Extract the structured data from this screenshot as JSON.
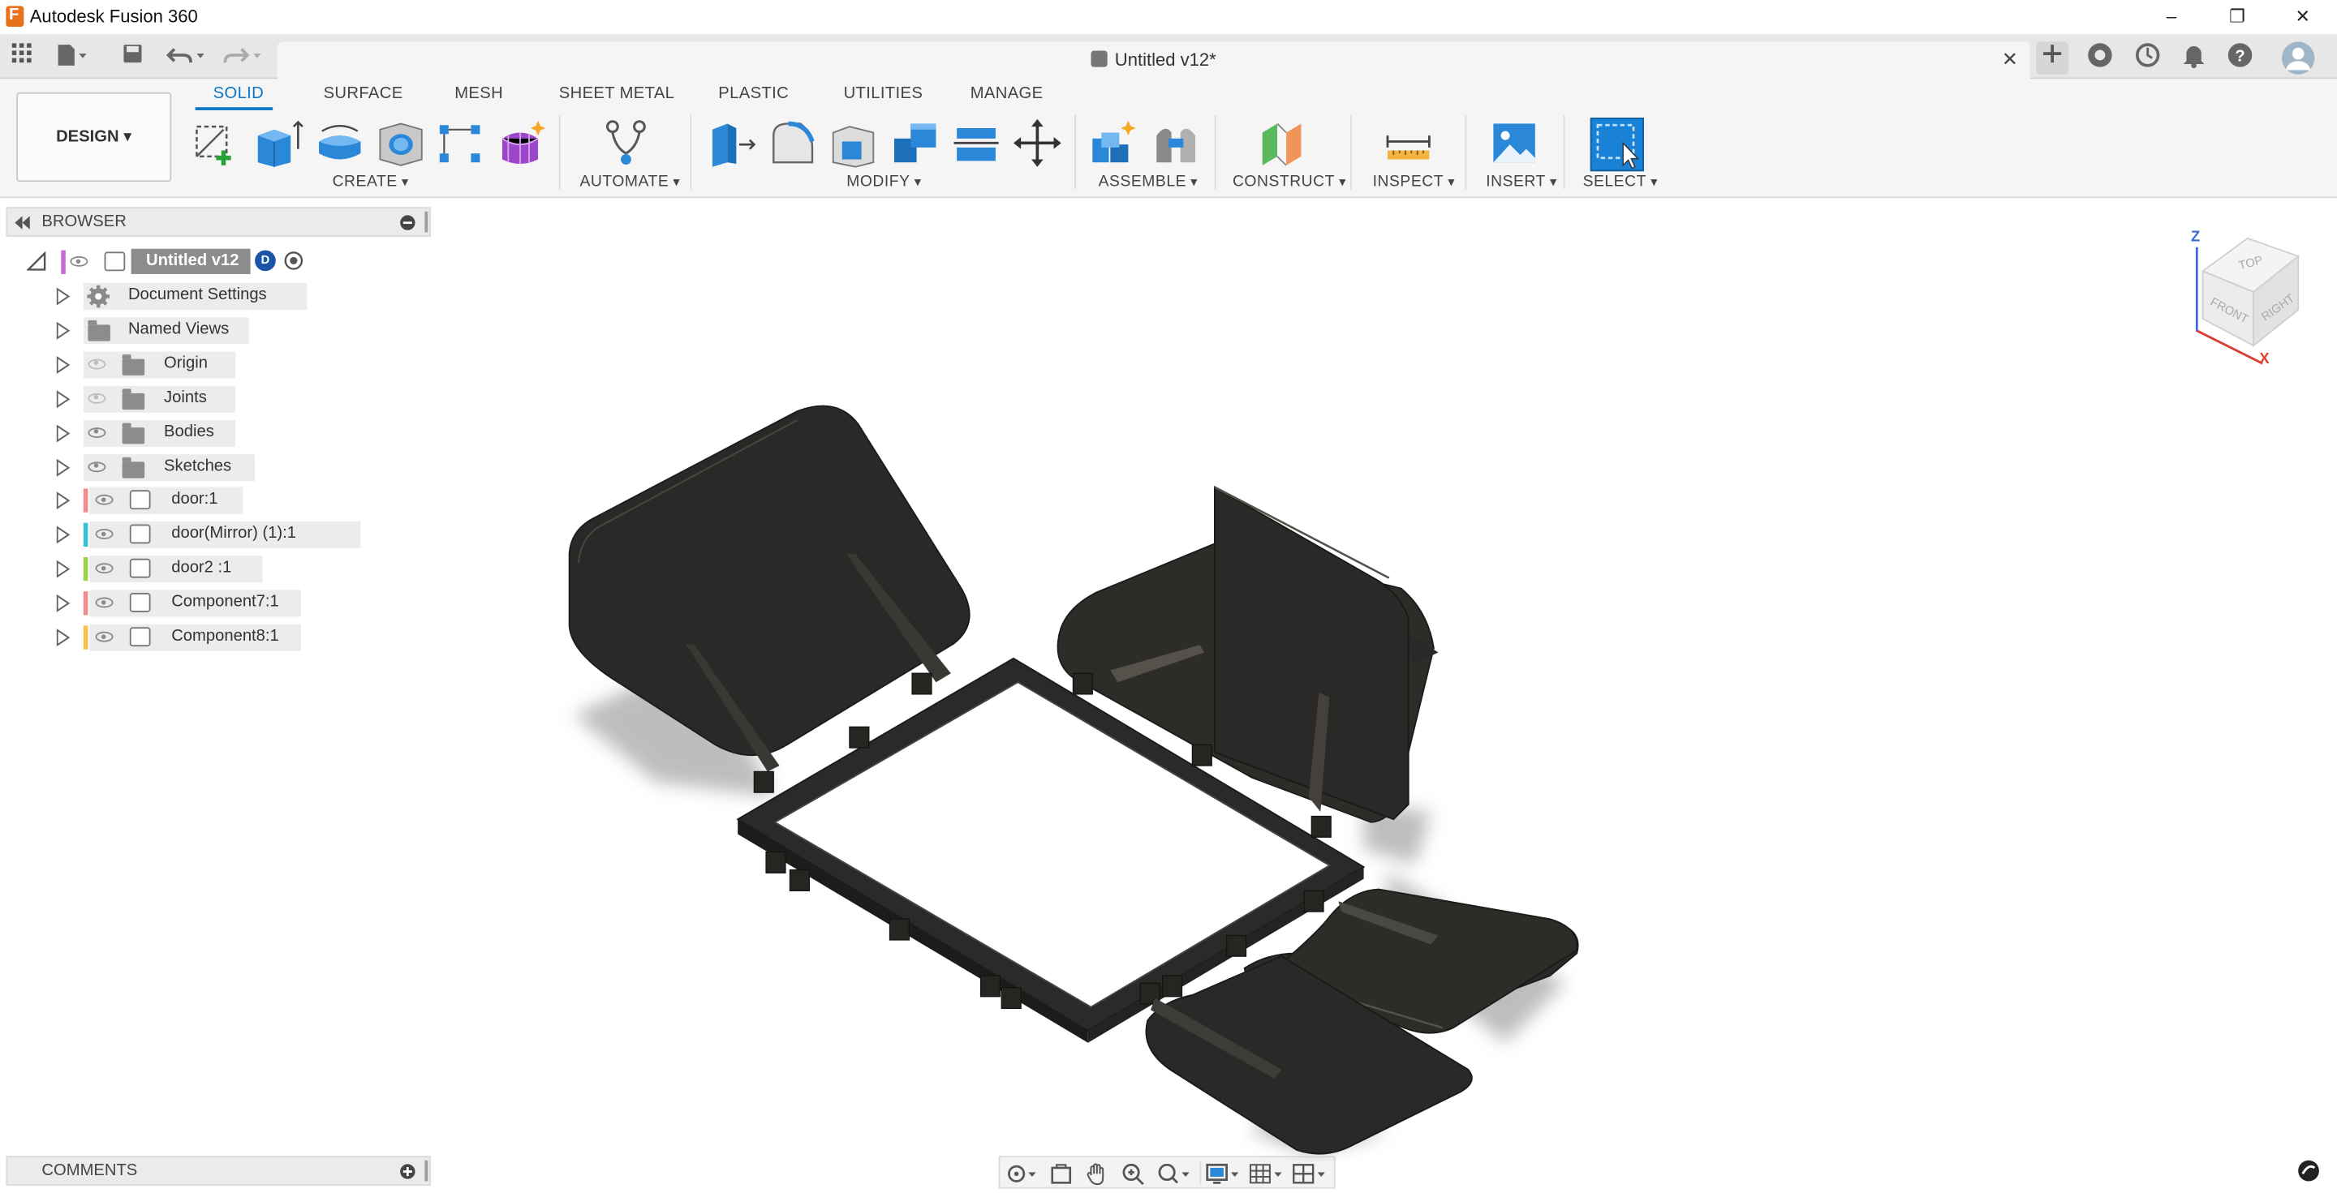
{
  "app": {
    "title": "Autodesk Fusion 360"
  },
  "window": {
    "minimize": "–",
    "restore": "❐",
    "close": "✕"
  },
  "document": {
    "tab_title": "Untitled v12*",
    "close": "✕"
  },
  "workspace": {
    "label": "DESIGN ▾"
  },
  "ribbon_tabs": [
    "SOLID",
    "SURFACE",
    "MESH",
    "SHEET METAL",
    "PLASTIC",
    "UTILITIES",
    "MANAGE"
  ],
  "ribbon_groups": {
    "create": "CREATE",
    "automate": "AUTOMATE",
    "modify": "MODIFY",
    "assemble": "ASSEMBLE",
    "construct": "CONSTRUCT",
    "inspect": "INSPECT",
    "insert": "INSERT",
    "select": "SELECT"
  },
  "browser": {
    "title": "BROWSER",
    "root": "Untitled v12",
    "items": [
      {
        "label": "Document Settings",
        "icon": "gear-icon"
      },
      {
        "label": "Named Views",
        "icon": "folder-icon"
      },
      {
        "label": "Origin",
        "icon": "folder-icon",
        "visible": false
      },
      {
        "label": "Joints",
        "icon": "folder-icon",
        "visible": false
      },
      {
        "label": "Bodies",
        "icon": "folder-icon",
        "visible": true
      },
      {
        "label": "Sketches",
        "icon": "folder-icon",
        "visible": true
      },
      {
        "label": "door:1",
        "icon": "component-icon",
        "color": "#f28b8b"
      },
      {
        "label": "door(Mirror) (1):1",
        "icon": "component-icon",
        "color": "#35c2d6"
      },
      {
        "label": "door2 :1",
        "icon": "component-icon",
        "color": "#9bd34a"
      },
      {
        "label": "Component7:1",
        "icon": "component-icon",
        "color": "#f28b8b"
      },
      {
        "label": "Component8:1",
        "icon": "component-icon",
        "color": "#f6c24a"
      }
    ]
  },
  "comments": {
    "title": "COMMENTS"
  },
  "viewcube": {
    "top": "TOP",
    "front": "FRONT",
    "right": "RIGHT",
    "axis_z": "Z",
    "axis_x": "X"
  },
  "colors": {
    "accent": "#0a77c8",
    "model": "#2b2a28",
    "app_orange": "#e8711c"
  }
}
